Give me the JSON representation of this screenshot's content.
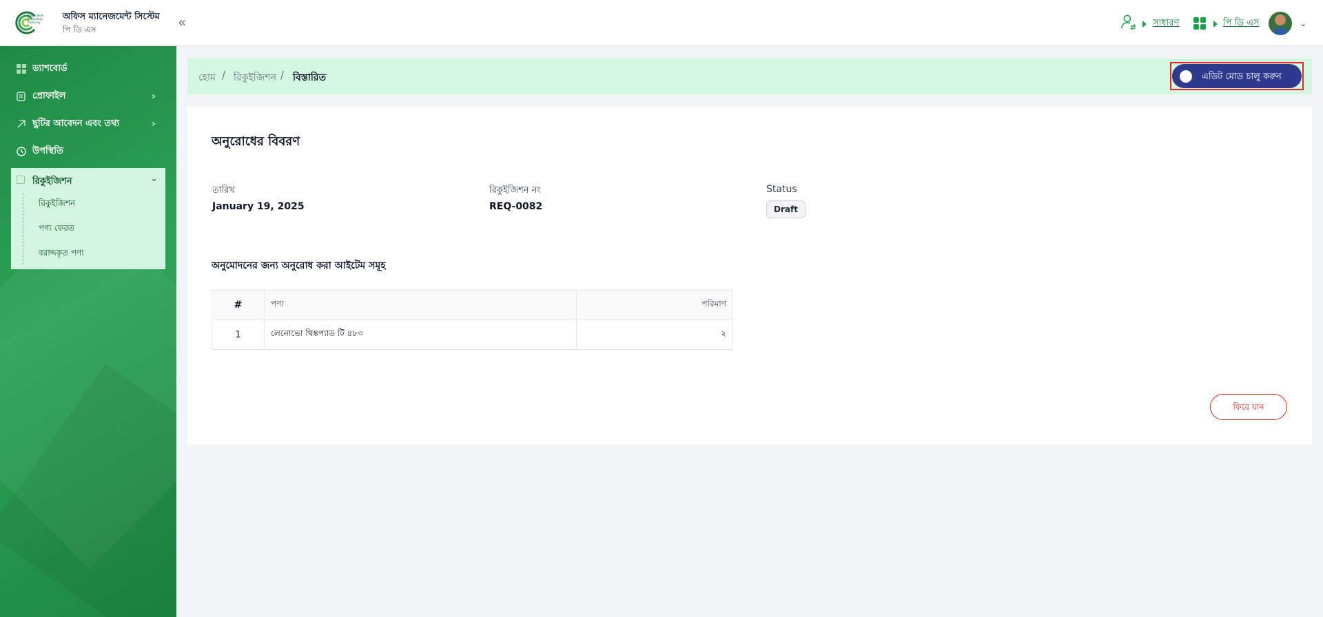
{
  "app": {
    "title": "অফিস ম্যানেজমেন্ট সিস্টেম",
    "subtitle": "পি ডি এস",
    "logo_text": [
      "Bangladesh",
      "Regulatory",
      "Authority"
    ]
  },
  "topbar": {
    "collapse_icon": "double-chevron-left-icon",
    "role_link": "সাধারণ",
    "module_link": "পি ডি এস"
  },
  "sidebar": {
    "items": [
      {
        "label": "ড্যাশবোর্ড",
        "icon": "grid-icon"
      },
      {
        "label": "প্রোফাইল",
        "icon": "profile-card-icon"
      },
      {
        "label": "ছুটির আবেদন এবং তথ্য",
        "icon": "leave-icon"
      },
      {
        "label": "উপস্থিতি",
        "icon": "clock-icon"
      }
    ],
    "requisition": {
      "label": "রিকুইজিশন",
      "subitems": [
        "রিকুইজিশন",
        "পণ্য ফেরত",
        "বরাদ্দকৃত পণ্য"
      ]
    }
  },
  "breadcrumb": {
    "home": "হোম",
    "section": "রিকুইজিশন",
    "current": "বিস্তারিত",
    "separator": "/"
  },
  "edit_mode": {
    "label": "এডিট মোড চালু করুন",
    "enabled": false
  },
  "detail": {
    "title": "অনুরোধের বিবরণ",
    "date_label": "তারিখ",
    "date_value": "January 19, 2025",
    "req_no_label": "রিকুইজিশন নং",
    "req_no_value": "REQ-0082",
    "status_label": "Status",
    "status_value": "Draft",
    "items_title": "অনুমোদনের জন্য অনুরোধ করা আইটেম সমূহ",
    "table": {
      "headers": [
        "#",
        "পণ্য",
        "পরিমাণ"
      ],
      "rows": [
        [
          "1",
          "লেনোভো থিঙ্কপ্যাড টি ৪৮০",
          "২"
        ]
      ]
    },
    "back_button": "ফিরে যান"
  },
  "colors": {
    "sidebar_green": "#2ea357",
    "breadcrumb_bg": "#d4f7e1",
    "toggle_bg": "#2f3a8f",
    "annotation_red": "#e3261f"
  }
}
